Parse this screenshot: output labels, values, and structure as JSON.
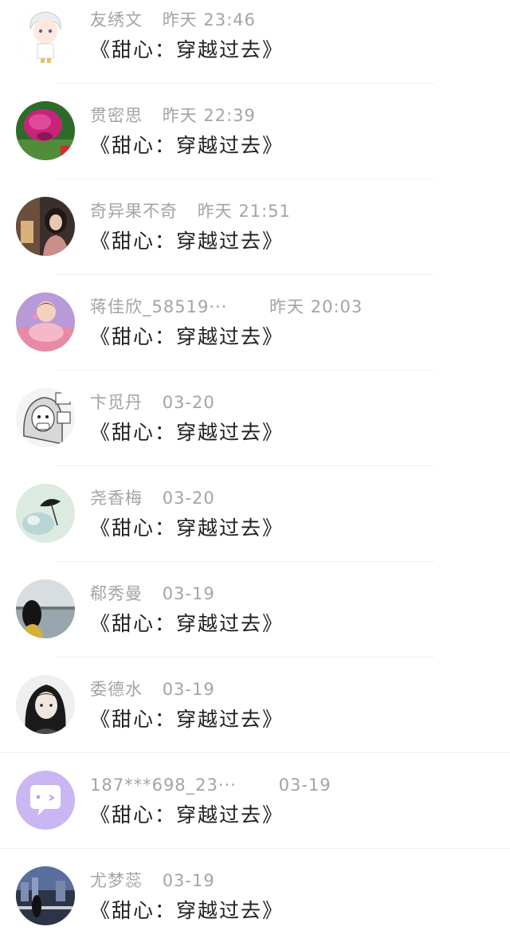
{
  "comments": [
    {
      "name": "友绣文",
      "time": "昨天 23:46",
      "title": "《甜心：穿越过去》",
      "avatar_icon": "anime-boy-avatar-icon"
    },
    {
      "name": "贯密思",
      "time": "昨天 22:39",
      "title": "《甜心：穿越过去》",
      "avatar_icon": "flower-avatar-icon"
    },
    {
      "name": "奇异果不奇",
      "time": "昨天 21:51",
      "title": "《甜心：穿越过去》",
      "avatar_icon": "girl-photo-avatar-icon"
    },
    {
      "name": "蒋佳欣_58519···",
      "time": "昨天 20:03",
      "title": "《甜心：穿越过去》",
      "avatar_icon": "baby-avatar-icon"
    },
    {
      "name": "卞觅丹",
      "time": "03-20",
      "title": "《甜心：穿越过去》",
      "avatar_icon": "manga-girl-avatar-icon"
    },
    {
      "name": "尧香梅",
      "time": "03-20",
      "title": "《甜心：穿越过去》",
      "avatar_icon": "rose-avatar-icon"
    },
    {
      "name": "郗秀曼",
      "time": "03-19",
      "title": "《甜心：穿越过去》",
      "avatar_icon": "lake-avatar-icon"
    },
    {
      "name": "委德水",
      "time": "03-19",
      "title": "《甜心：穿越过去》",
      "avatar_icon": "woman-portrait-avatar-icon"
    },
    {
      "name": "187***698_23···",
      "time": "03-19",
      "title": "《甜心：穿越过去》",
      "avatar_icon": "chat-bubble-avatar-icon"
    },
    {
      "name": "尤梦蕊",
      "time": "03-19",
      "title": "《甜心：穿越过去》",
      "avatar_icon": "city-avatar-icon"
    }
  ],
  "colors": {
    "meta_text": "#a4a4a4",
    "title_text": "#1f1f1f",
    "divider": "#efefef",
    "default_avatar": "#c9b6f2"
  }
}
